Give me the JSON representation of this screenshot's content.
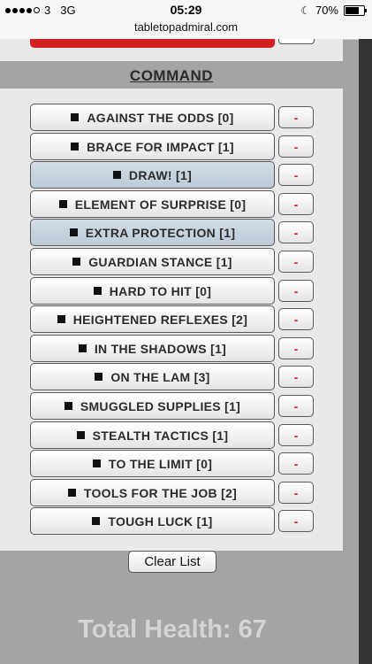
{
  "status": {
    "carrier": "3",
    "network": "3G",
    "time": "05:29",
    "url": "tabletopadmiral.com",
    "battery": "70%"
  },
  "section_title": "COMMAND",
  "items": [
    {
      "label": "AGAINST THE ODDS [0]",
      "selected": false,
      "remove": "-"
    },
    {
      "label": "BRACE FOR IMPACT [1]",
      "selected": false,
      "remove": "-"
    },
    {
      "label": "DRAW! [1]",
      "selected": true,
      "remove": "-"
    },
    {
      "label": "ELEMENT OF SURPRISE [0]",
      "selected": false,
      "remove": "-"
    },
    {
      "label": "EXTRA PROTECTION [1]",
      "selected": true,
      "remove": "-"
    },
    {
      "label": "GUARDIAN STANCE [1]",
      "selected": false,
      "remove": "-"
    },
    {
      "label": "HARD TO HIT [0]",
      "selected": false,
      "remove": "-"
    },
    {
      "label": "HEIGHTENED REFLEXES [2]",
      "selected": false,
      "remove": "-"
    },
    {
      "label": "IN THE SHADOWS [1]",
      "selected": false,
      "remove": "-"
    },
    {
      "label": "ON THE LAM [3]",
      "selected": false,
      "remove": "-"
    },
    {
      "label": "SMUGGLED SUPPLIES [1]",
      "selected": false,
      "remove": "-"
    },
    {
      "label": "STEALTH TACTICS [1]",
      "selected": false,
      "remove": "-"
    },
    {
      "label": "TO THE LIMIT [0]",
      "selected": false,
      "remove": "-"
    },
    {
      "label": "TOOLS FOR THE JOB [2]",
      "selected": false,
      "remove": "-"
    },
    {
      "label": "TOUGH LUCK [1]",
      "selected": false,
      "remove": "-"
    }
  ],
  "clear_label": "Clear List",
  "total_health": "Total Health: 67",
  "colors": {
    "accent_red": "#d51f1f",
    "selected_row": "#c8d5df",
    "minus_red": "#e01818"
  }
}
